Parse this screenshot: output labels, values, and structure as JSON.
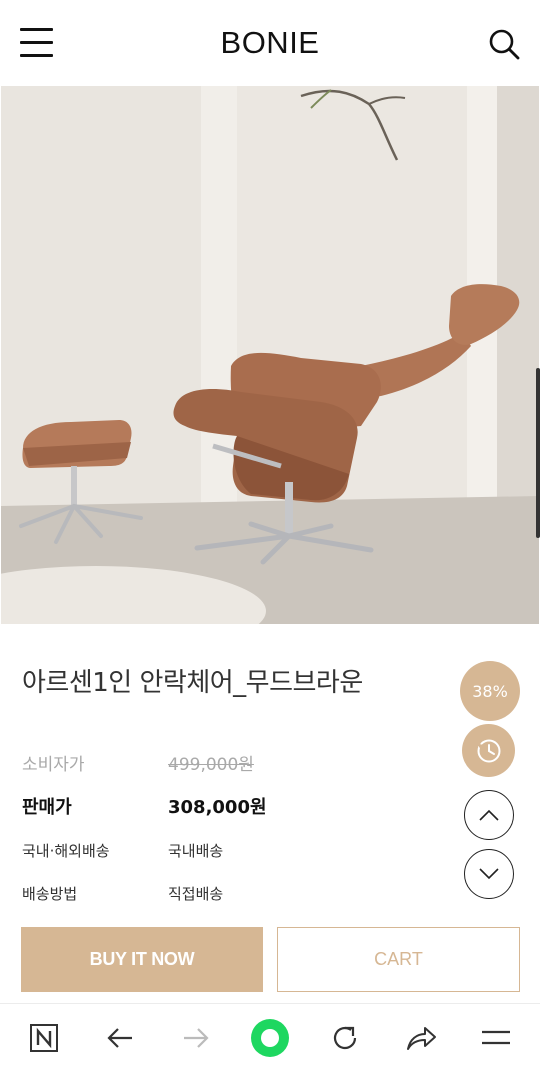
{
  "header": {
    "logo": "BONIE"
  },
  "product": {
    "title": "아르센1인 안락체어_무드브라운",
    "consumer_price_label": "소비자가",
    "consumer_price": "499,000원",
    "sale_price_label": "판매가",
    "sale_price": "308,000원",
    "shipping_label": "국내·해외배송",
    "shipping_value": "국내배송",
    "method_label": "배송방법",
    "method_value": "직접배송"
  },
  "side": {
    "discount": "38%"
  },
  "actions": {
    "buy_now": "BUY IT NOW",
    "cart": "CART"
  },
  "colors": {
    "accent": "#d6b794",
    "browser_green": "#1ed760"
  },
  "icons": {
    "menu": "hamburger-icon",
    "search": "search-icon",
    "recent": "clock-icon",
    "up": "chevron-up-icon",
    "down": "chevron-down-icon",
    "naver": "naver-n-icon",
    "back": "arrow-left-icon",
    "forward": "arrow-right-icon",
    "home": "green-dot-icon",
    "refresh": "refresh-icon",
    "share": "share-icon",
    "more": "menu-lines-icon"
  }
}
